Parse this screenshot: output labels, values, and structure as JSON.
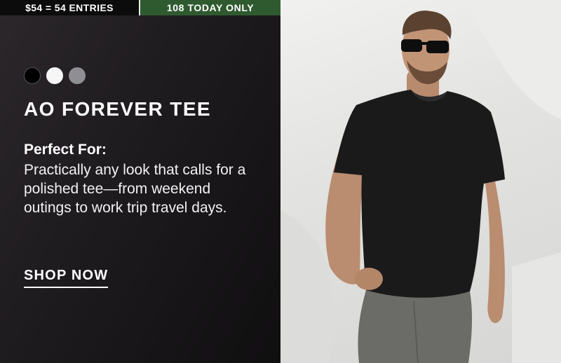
{
  "promo": {
    "left_text": "$54 = 54 ENTRIES",
    "right_text": "108 TODAY ONLY"
  },
  "product": {
    "swatches": [
      {
        "name": "black",
        "color": "#000000"
      },
      {
        "name": "white",
        "color": "#f6f6f6"
      },
      {
        "name": "grey",
        "color": "#8f8f93"
      }
    ],
    "title": "AO FOREVER TEE",
    "perfect_for_label": "Perfect For:",
    "perfect_for_text": "Practically any look that calls for a polished tee—from weekend outings to work trip travel days.",
    "cta_label": "SHOP NOW"
  },
  "colors": {
    "promo_left_bg": "#0d0c0d",
    "promo_right_bg": "#2f5a30",
    "panel_bg": "#1a181a",
    "text": "#ffffff"
  }
}
